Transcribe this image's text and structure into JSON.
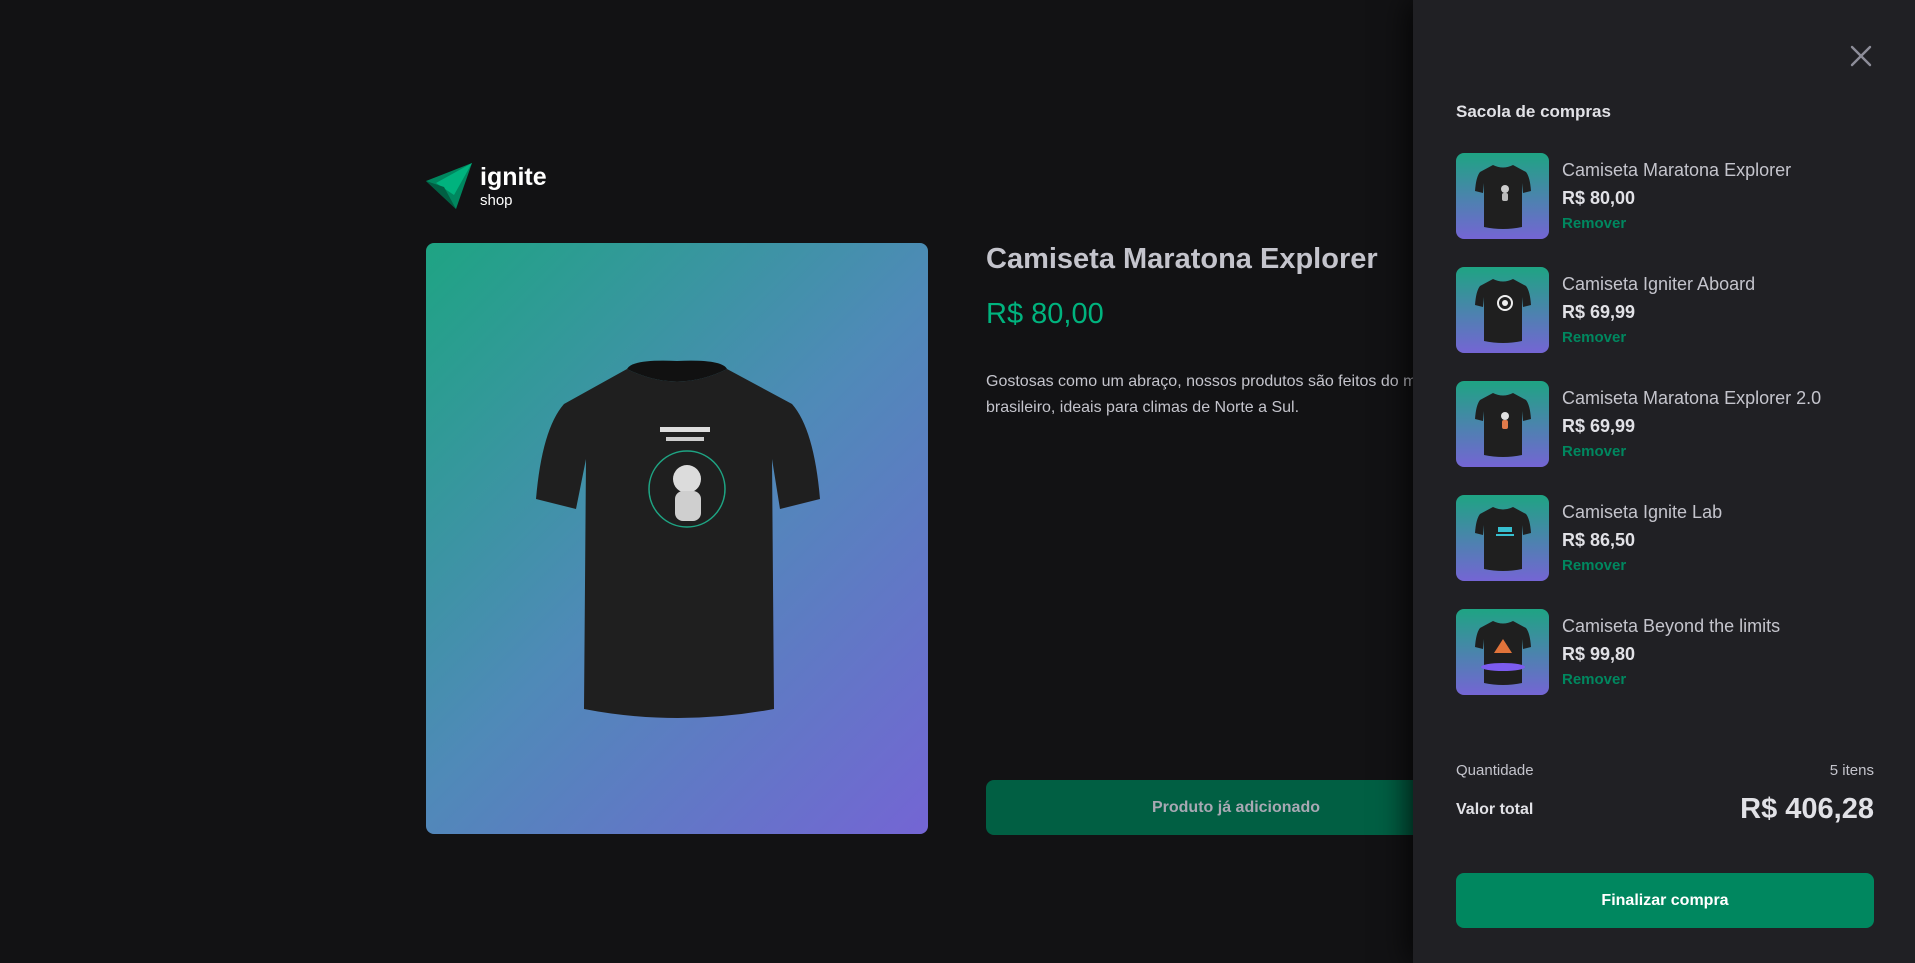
{
  "brand": {
    "title": "ignite",
    "subtitle": "shop",
    "logo_icon": "ignite-logo-icon"
  },
  "colors": {
    "background": "#121214",
    "accent": "#00875f",
    "accent_light": "#00b37e",
    "cart_bg": "#202024",
    "gradient_start": "#1ea483",
    "gradient_end": "#7465d4"
  },
  "product": {
    "title": "Camiseta Maratona Explorer",
    "price": "R$ 80,00",
    "description": "Gostosas como um abraço, nossos produtos são feitos do mais suave e nobre algodão brasileiro, ideais para climas de Norte a Sul.",
    "image_icon": "tshirt-icon",
    "button_label": "Produto já adicionado"
  },
  "cart": {
    "title": "Sacola de compras",
    "close_icon": "close-icon",
    "items": [
      {
        "name": "Camiseta Maratona Explorer",
        "price": "R$ 80,00",
        "remove_label": "Remover"
      },
      {
        "name": "Camiseta Igniter Aboard",
        "price": "R$ 69,99",
        "remove_label": "Remover"
      },
      {
        "name": "Camiseta Maratona Explorer 2.0",
        "price": "R$ 69,99",
        "remove_label": "Remover"
      },
      {
        "name": "Camiseta Ignite Lab",
        "price": "R$ 86,50",
        "remove_label": "Remover"
      },
      {
        "name": "Camiseta Beyond the limits",
        "price": "R$ 99,80",
        "remove_label": "Remover"
      }
    ],
    "quantity_label": "Quantidade",
    "quantity_value": "5 itens",
    "total_label": "Valor total",
    "total_value": "R$ 406,28",
    "checkout_label": "Finalizar compra"
  }
}
